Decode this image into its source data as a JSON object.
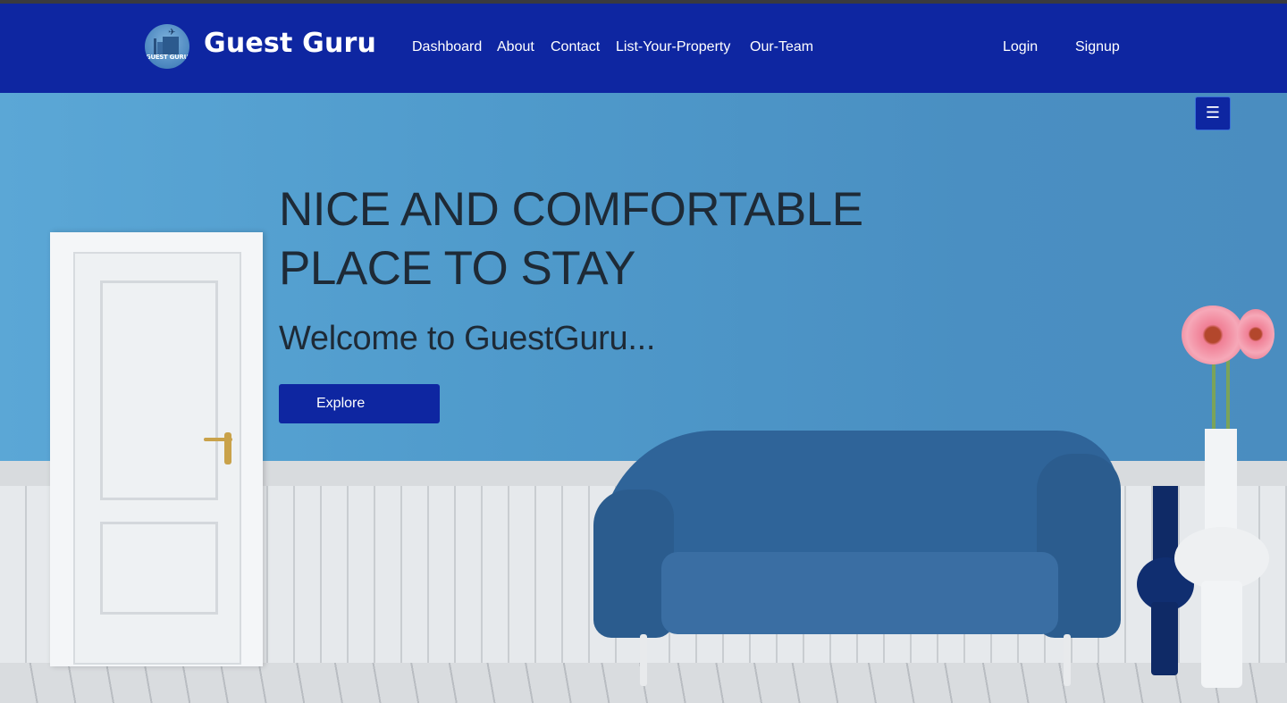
{
  "brand": {
    "name": "Guest Guru",
    "logo_text": "GUEST GURU",
    "logo_icon": "hotel-plane-logo"
  },
  "nav": {
    "links": [
      "Dashboard",
      "About",
      "Contact",
      "List-Your-Property",
      "Our-Team"
    ],
    "auth": [
      "Login",
      "Signup"
    ]
  },
  "menu_button": {
    "glyph": "☰",
    "icon": "hamburger-icon"
  },
  "hero": {
    "heading": "NICE AND COMFORTABLE PLACE TO STAY",
    "subheading": "Welcome to GuestGuru...",
    "cta": "Explore"
  },
  "colors": {
    "brand_blue": "#0e26a1",
    "hero_text": "#1e2a36",
    "wall_blue": "#4f9acb"
  }
}
